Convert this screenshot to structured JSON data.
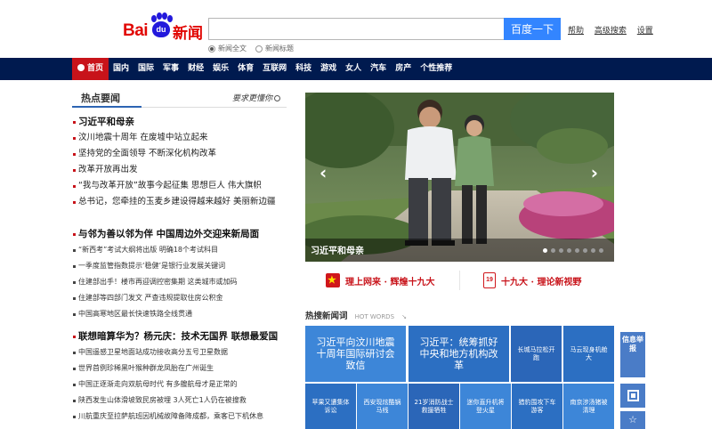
{
  "header": {
    "logo_bai": "Bai",
    "logo_du": "du",
    "logo_news": "新闻",
    "search_value": "",
    "search_button": "百度一下",
    "links": [
      "帮助",
      "高级搜索",
      "设置"
    ],
    "radio_options": [
      {
        "label": "新闻全文",
        "selected": true
      },
      {
        "label": "新闻标题",
        "selected": false
      }
    ]
  },
  "nav": {
    "items": [
      "首页",
      "国内",
      "国际",
      "军事",
      "财经",
      "娱乐",
      "体育",
      "互联网",
      "科技",
      "游戏",
      "女人",
      "汽车",
      "房产",
      "个性推荐"
    ],
    "active": "首页",
    "bg_color": "#001a4f",
    "active_color": "#c8131a"
  },
  "left": {
    "section_title": "热点要闻",
    "slogan": "要求更懂你",
    "groups": [
      {
        "headline": "习近平和母亲",
        "items": [
          "汶川地震十周年 在废墟中站立起来",
          "坚持党的全面领导 不断深化机构改革",
          "改革开放再出发",
          "“我与改革开放”故事今起征集 思想巨人 伟大旗帜",
          "总书记，您牵挂的玉麦乡建设得越来越好 美丽新边疆"
        ]
      },
      {
        "headline": "与邻为善以邻为伴 中国周边外交迎来新局面",
        "items": [
          "“新西考”考试大纲将出版 明确18个考试科目",
          "一季度监管指数提示‘稳健’是银行业发展关键词",
          "住建部出手！楼市再迎调控密集期 这类城市或加码",
          "住建部等四部门发文 严查违规提取住房公积金",
          "中国高寒地区最长快速铁路全线贯通"
        ]
      },
      {
        "headline": "联想暗算华为？杨元庆：技术无国界 联想最爱国",
        "items": [
          "中国遥感卫星地面站成功接收高分五号卫星数据",
          "世界首例珍稀黑叶猴种群龙凤胎在广州诞生",
          "中国正逐渐走向双航母时代 有多艘航母才是正常的",
          "陕西发生山体滑坡致民房被埋 3人死亡1人仍在被搜救",
          "川航重庆至拉萨航班因机械故障备降成都，乘客已下机休息"
        ]
      }
    ]
  },
  "carousel": {
    "caption": "习近平和母亲",
    "prev": "‹",
    "next": "›",
    "dot_count": 8,
    "active_dot": 0
  },
  "banners": [
    {
      "icon": "party-flag-icon",
      "text": "理上网来 · 辉煌十九大"
    },
    {
      "icon": "nineteen-badge-icon",
      "badge": "19",
      "text": "十九大 · 理论新视野"
    }
  ],
  "hot": {
    "title": "热搜新闻词",
    "subtitle": "HOT WORDS",
    "tiles": [
      {
        "text": "习近平向汶川地震十周年国际研讨会致信",
        "color": "#3d86d8"
      },
      {
        "text": "习近平：统筹抓好中央和地方机构改革",
        "color": "#2c6fc2"
      },
      {
        "text": "长城马拉松开跑",
        "color": "#2b66b8"
      },
      {
        "text": "马云现身机舱大",
        "color": "#2c6fc2"
      },
      {
        "text": "苹果又遭集体诉讼",
        "color": "#2c6fc2"
      },
      {
        "text": "西安现炫酷锅马线",
        "color": "#3d86d8"
      },
      {
        "text": "21岁消防战士救援牺牲",
        "color": "#2b66b8"
      },
      {
        "text": "迷你直升机将登火星",
        "color": "#3d86d8"
      },
      {
        "text": "猎豹围攻下车游客",
        "color": "#2c6fc2"
      },
      {
        "text": "南京涉汤猪被清理",
        "color": "#3d86d8"
      }
    ]
  },
  "sidebar": {
    "report": "信息举报",
    "qr": "qr-code-icon",
    "fav": "☆"
  }
}
